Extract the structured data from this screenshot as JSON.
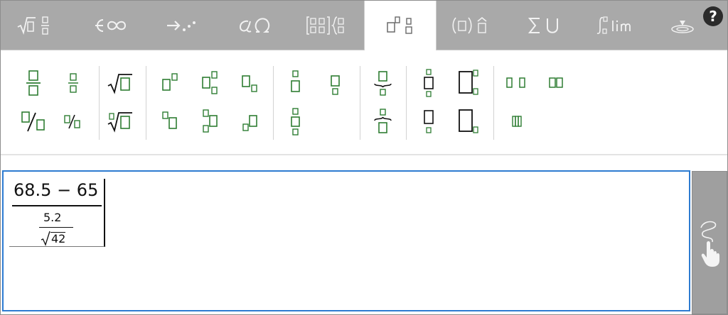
{
  "tabs": [
    {
      "id": "fractions-roots",
      "label": "√▯ ▯/▯",
      "active": false
    },
    {
      "id": "sets-infinity",
      "label": "∈ ∞",
      "active": false
    },
    {
      "id": "arrows-dots",
      "label": "→ ⋰",
      "active": false
    },
    {
      "id": "greek",
      "label": "α Ω",
      "active": false
    },
    {
      "id": "matrices",
      "label": "[▯▯] {▯",
      "active": false
    },
    {
      "id": "scripts",
      "label": "",
      "active": true
    },
    {
      "id": "brackets-accents",
      "label": "(▯) ▯̂",
      "active": false
    },
    {
      "id": "big-operators",
      "label": "Σ U",
      "active": false
    },
    {
      "id": "calculus",
      "label": "∫▯ lim",
      "active": false
    }
  ],
  "help": {
    "label": "?"
  },
  "expression": {
    "numerator": "68.5 − 65",
    "denominator_fraction": {
      "numerator": "5.2",
      "radicand": "42"
    }
  },
  "colors": {
    "tab_bar": "#a9a9a9",
    "palette_glyph": "#2e7d32",
    "focus_border": "#2d7bd1"
  },
  "icons": {
    "hand_button": "handwriting-hand-icon",
    "tab_extra": "handwriting-stroke-icon"
  }
}
